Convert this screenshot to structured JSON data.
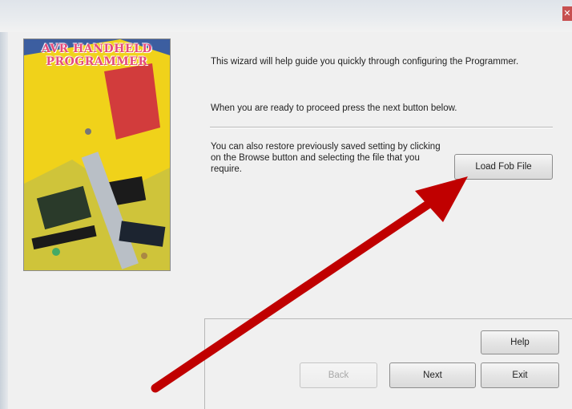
{
  "window": {
    "close_glyph": "✕"
  },
  "banner": {
    "line1": "AVR HANDHELD",
    "line2": "PROGRAMMER"
  },
  "text": {
    "intro": "This wizard will help guide you quickly through configuring the Programmer.",
    "proceed": "When you are ready to proceed press the next button below.",
    "restore": "You can also restore previously saved setting by clicking on the Browse button and selecting the file that you require."
  },
  "buttons": {
    "load": "Load Fob File",
    "help": "Help",
    "back": "Back",
    "next": "Next",
    "exit": "Exit"
  },
  "colors": {
    "arrow": "#c00000",
    "banner_title": "#e54a7a"
  }
}
